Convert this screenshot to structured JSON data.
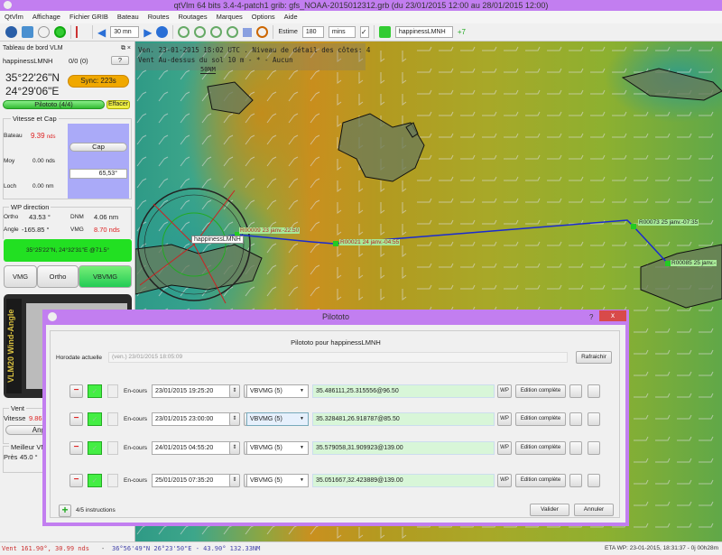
{
  "window": {
    "title": "qtVlm 64 bits 3.4-4-patch1 grib: gfs_NOAA-2015012312.grb (du 23/01/2015 12:00 au 28/01/2015 12:00)"
  },
  "menu": [
    "QtVlm",
    "Affichage",
    "Fichier GRIB",
    "Bateau",
    "Routes",
    "Routages",
    "Marques",
    "Options",
    "Aide"
  ],
  "toolbar": {
    "step": "30 mn",
    "estime_label": "Estime",
    "estime_value": "180",
    "estime_unit": "mins",
    "estime_checked": true,
    "boat": "happinessLMNH",
    "extra": "+7"
  },
  "dashboard": {
    "title": "Tableau de bord VLM",
    "boat": "happinessLMNH",
    "rank": "0/0 (0)",
    "help": "?",
    "lat": "35°22'26\"N",
    "lon": "24°29'06\"E",
    "sync": "Sync: 223s",
    "pilototo": "Pilototo (4/4)",
    "effacer": "Effacer",
    "speed_group": "Vitesse et Cap",
    "bateau_label": "Bateau",
    "bateau_value": "9.39",
    "bateau_unit": "nds",
    "moy_label": "Moy",
    "moy_value": "0.00 nds",
    "loch_label": "Loch",
    "loch_value": "0.00 nm",
    "cap_button": "Cap",
    "cap_value": "65,53°",
    "wp_group": "WP direction",
    "ortho_label": "Ortho",
    "ortho_value": "43.53 °",
    "dnm_label": "DNM",
    "dnm_value": "4.06 nm",
    "angle_label": "Angle",
    "angle_value": "-165.85 °",
    "vmg_label": "VMG",
    "vmg_value": "8.70 nds",
    "wp_position": "35°25'22\"N, 24°32'31\"E @71.5°",
    "modes": [
      {
        "label": "VMG",
        "active": false
      },
      {
        "label": "Ortho",
        "active": false
      },
      {
        "label": "VBVMG",
        "active": true
      }
    ],
    "instrument": "VLM20 Wind-Angle",
    "vent_group": "Vent",
    "vitesse_label": "Vitesse",
    "vitesse_value": "9.86",
    "angle_button": "Angle",
    "meilleur_group": "Meilleur VMG",
    "pres_label": "Près",
    "pres_value": "45.0 °"
  },
  "map": {
    "info1": "Ven. 23-01-2015 18:02 UTC . Niveau de détail des côtes: 4",
    "info2": "Vent Au-dessus du sol 10 m - * - Aucun",
    "scale": "50NM",
    "boat_label": "happinessLMNH",
    "waypoints": [
      {
        "label": "R00009 23 janv.-22:50"
      },
      {
        "label": "R00021 24 janv.-04:55"
      },
      {
        "label": "R00073 25 janv.-07:35"
      },
      {
        "label": "R00085 25 janv.-"
      }
    ],
    "colors": {
      "route": "#1a2bd0",
      "waypoint": "#22cc22"
    }
  },
  "dialog": {
    "title": "Pilototo",
    "help": "?",
    "close": "x",
    "heading": "Pilototo pour happinessLMNH",
    "horodate_label": "Horodate actuelle",
    "horodate_value": "(ven.) 23/01/2015 18:05:09",
    "refresh": "Rafraichir",
    "rows": [
      {
        "status": "En-cours",
        "date": "23/01/2015 19:25:20",
        "mode": "VBVMG (5)",
        "target": "35.486111,25.315556@96.50"
      },
      {
        "status": "En-cours",
        "date": "23/01/2015 23:00:00",
        "mode": "VBVMG (5)",
        "target": "35.328481,26.918787@85.50"
      },
      {
        "status": "En-cours",
        "date": "24/01/2015 04:55:20",
        "mode": "VBVMG (5)",
        "target": "35.579058,31.909923@139.00"
      },
      {
        "status": "En-cours",
        "date": "25/01/2015 07:35:20",
        "mode": "VBVMG (5)",
        "target": "35.051667,32.423889@139.00"
      }
    ],
    "wp_button": "WP",
    "edit_button": "Edition complète",
    "count": "4/5 instructions",
    "validate": "Valider",
    "cancel": "Annuler"
  },
  "status": {
    "wind": "Vent 161.90°,  30.99 nds",
    "sep": "-",
    "cursor": "36°56'49\"N  26°23'50\"E -  43.90°  132.33NM",
    "eta": "ETA WP: 23-01-2015, 18:31:37 - 0j 00h28m"
  }
}
